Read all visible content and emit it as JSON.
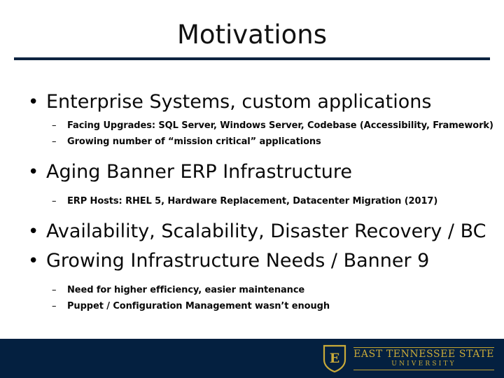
{
  "slide": {
    "title": "Motivations",
    "accent_navy": "#042040",
    "accent_gold": "#c9aa39",
    "rule_color": "#0d2340"
  },
  "bullets": [
    {
      "level": 1,
      "marker": "•",
      "text": "Enterprise Systems, custom applications"
    },
    {
      "level": 2,
      "marker": "–",
      "text": "Facing Upgrades: SQL Server, Windows Server, Codebase (Accessibility, Framework)"
    },
    {
      "level": 2,
      "marker": "–",
      "text": "Growing number of “mission critical” applications"
    },
    {
      "level": 1,
      "marker": "•",
      "text": "Aging Banner ERP Infrastructure"
    },
    {
      "level": 2,
      "marker": "–",
      "text": "ERP Hosts: RHEL 5, Hardware Replacement, Datacenter Migration (2017)"
    },
    {
      "level": 1,
      "marker": "•",
      "text": "Availability, Scalability, Disaster Recovery / BC"
    },
    {
      "level": 1,
      "marker": "•",
      "text": "Growing Infrastructure Needs / Banner 9"
    },
    {
      "level": 2,
      "marker": "–",
      "text": "Need for higher efficiency, easier maintenance"
    },
    {
      "level": 2,
      "marker": "–",
      "text": "Puppet / Configuration Management wasn’t enough"
    }
  ],
  "footer": {
    "logo": {
      "shield_letter": "E",
      "wordmark_line1": "EAST TENNESSEE STATE",
      "wordmark_line2": "UNIVERSITY"
    }
  }
}
